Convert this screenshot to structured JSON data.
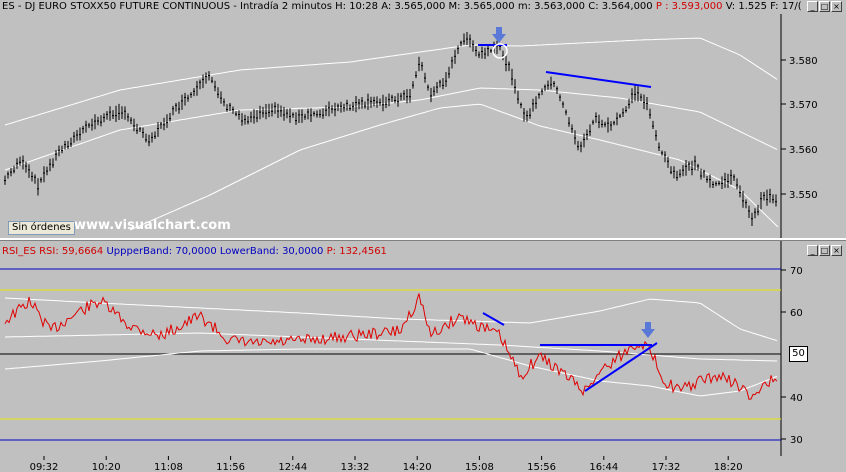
{
  "header": {
    "symbol": "ES",
    "name": "DJ EURO STOXX50 FUTURE CONTINUOUS",
    "timeframe": "Intradía 2 minutos",
    "h_label": "H:",
    "h_value": "10:28",
    "a_label": "A:",
    "a_value": "3.565,000",
    "m_label": "M:",
    "m_value": "3.565,000",
    "mm_label": "m:",
    "mm_value": "3.563,000",
    "c_label": "C:",
    "c_value": "3.564,000",
    "p_label": "P :",
    "p_value": "3.593,000",
    "v_label": "V:",
    "v_value": "1.525",
    "f_label": "F:",
    "f_value": "17/("
  },
  "price_axis": {
    "ticks": [
      "3.580",
      "3.570",
      "3.560",
      "3.550"
    ]
  },
  "order_button": "Sin órdenes",
  "watermark": "www.visualchart.com",
  "rsi_header": {
    "name": "RSI_ES",
    "rsi_label": "RSI:",
    "rsi_value": "59,6664",
    "upper_label": "UppperBand:",
    "upper_value": "70,0000",
    "lower_label": "LowerBand:",
    "lower_value": "30,0000",
    "p_label": "P:",
    "p_value": "132,4561"
  },
  "rsi_axis": {
    "ticks": [
      "70",
      "60",
      "50",
      "40",
      "30"
    ],
    "current": "50"
  },
  "time_axis": {
    "ticks": [
      "09:32",
      "10:20",
      "11:08",
      "11:56",
      "12:44",
      "13:32",
      "14:20",
      "15:08",
      "15:56",
      "16:44",
      "17:32",
      "18:20"
    ]
  },
  "window_buttons": {
    "min": "_",
    "max": "□",
    "close": "×"
  },
  "colors": {
    "background": "#c0c0c0",
    "price": "#000000",
    "bands": "#ffffff",
    "rsi": "#e00000",
    "trendline": "#0000ff",
    "arrow": "#5a78d8",
    "levels": "#ffff00",
    "boundary": "#0000c0"
  }
}
